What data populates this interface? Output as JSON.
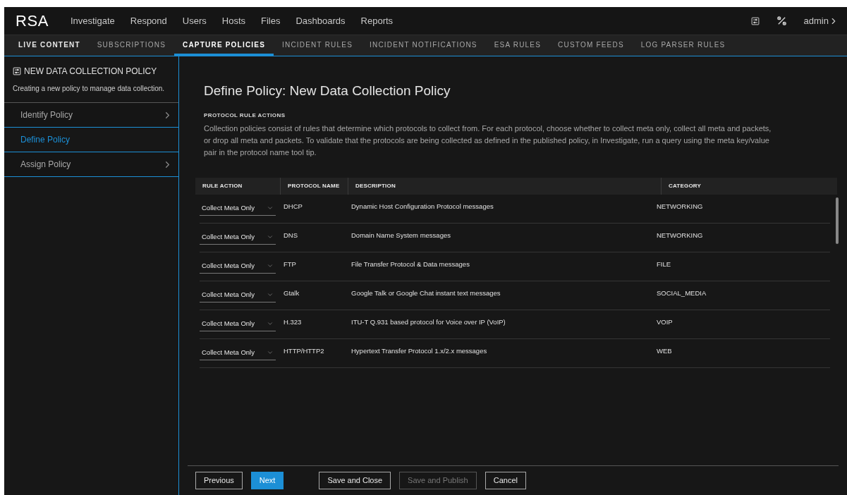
{
  "top_nav": {
    "logo": "RSA",
    "items": [
      "Investigate",
      "Respond",
      "Users",
      "Hosts",
      "Files",
      "Dashboards",
      "Reports"
    ],
    "user": "admin"
  },
  "sub_tabs": [
    {
      "label": "LIVE CONTENT",
      "selected": false,
      "bold": true
    },
    {
      "label": "SUBSCRIPTIONS",
      "selected": false,
      "bold": false
    },
    {
      "label": "CAPTURE POLICIES",
      "selected": true,
      "bold": true
    },
    {
      "label": "INCIDENT RULES",
      "selected": false,
      "bold": false
    },
    {
      "label": "INCIDENT NOTIFICATIONS",
      "selected": false,
      "bold": false
    },
    {
      "label": "ESA RULES",
      "selected": false,
      "bold": false
    },
    {
      "label": "CUSTOM FEEDS",
      "selected": false,
      "bold": false
    },
    {
      "label": "LOG PARSER RULES",
      "selected": false,
      "bold": false
    }
  ],
  "sidebar": {
    "title": "NEW DATA COLLECTION POLICY",
    "subtitle": "Creating a new policy to manage data collection.",
    "steps": [
      {
        "label": "Identify Policy",
        "selected": false
      },
      {
        "label": "Define Policy",
        "selected": true
      },
      {
        "label": "Assign Policy",
        "selected": false
      }
    ]
  },
  "main": {
    "title": "Define Policy: New Data Collection Policy",
    "section": "PROTOCOL RULE ACTIONS",
    "description": "Collection policies consist of rules that determine which protocols to collect from. For each protocol, choose whether to collect meta only, collect all meta and packets, or drop all meta and packets. To validate that the protocols are being collected as defined in the published policy, in Investigate, run a query using the meta key/value pair in the protocol name tool tip."
  },
  "table": {
    "columns": [
      "RULE ACTION",
      "PROTOCOL NAME",
      "DESCRIPTION",
      "CATEGORY"
    ],
    "rows": [
      {
        "rule_action": "Collect Meta Only",
        "protocol": "DHCP",
        "description": "Dynamic Host Configuration Protocol messages",
        "category": "NETWORKING"
      },
      {
        "rule_action": "Collect Meta Only",
        "protocol": "DNS",
        "description": "Domain Name System messages",
        "category": "NETWORKING"
      },
      {
        "rule_action": "Collect Meta Only",
        "protocol": "FTP",
        "description": "File Transfer Protocol & Data messages",
        "category": "FILE"
      },
      {
        "rule_action": "Collect Meta Only",
        "protocol": "Gtalk",
        "description": "Google Talk or Google Chat instant text messages",
        "category": "SOCIAL_MEDIA"
      },
      {
        "rule_action": "Collect Meta Only",
        "protocol": "H.323",
        "description": "ITU-T Q.931 based protocol for Voice over IP (VoIP)",
        "category": "VOIP"
      },
      {
        "rule_action": "Collect Meta Only",
        "protocol": "HTTP/HTTP2",
        "description": "Hypertext Transfer Protocol 1.x/2.x messages",
        "category": "WEB"
      }
    ]
  },
  "footer_buttons": [
    {
      "label": "Previous",
      "kind": "secondary",
      "disabled": false
    },
    {
      "label": "Next",
      "kind": "primary",
      "disabled": false
    },
    {
      "label": "Save and Close",
      "kind": "secondary",
      "disabled": false
    },
    {
      "label": "Save and Publish",
      "kind": "secondary",
      "disabled": true
    },
    {
      "label": "Cancel",
      "kind": "secondary",
      "disabled": false
    }
  ]
}
